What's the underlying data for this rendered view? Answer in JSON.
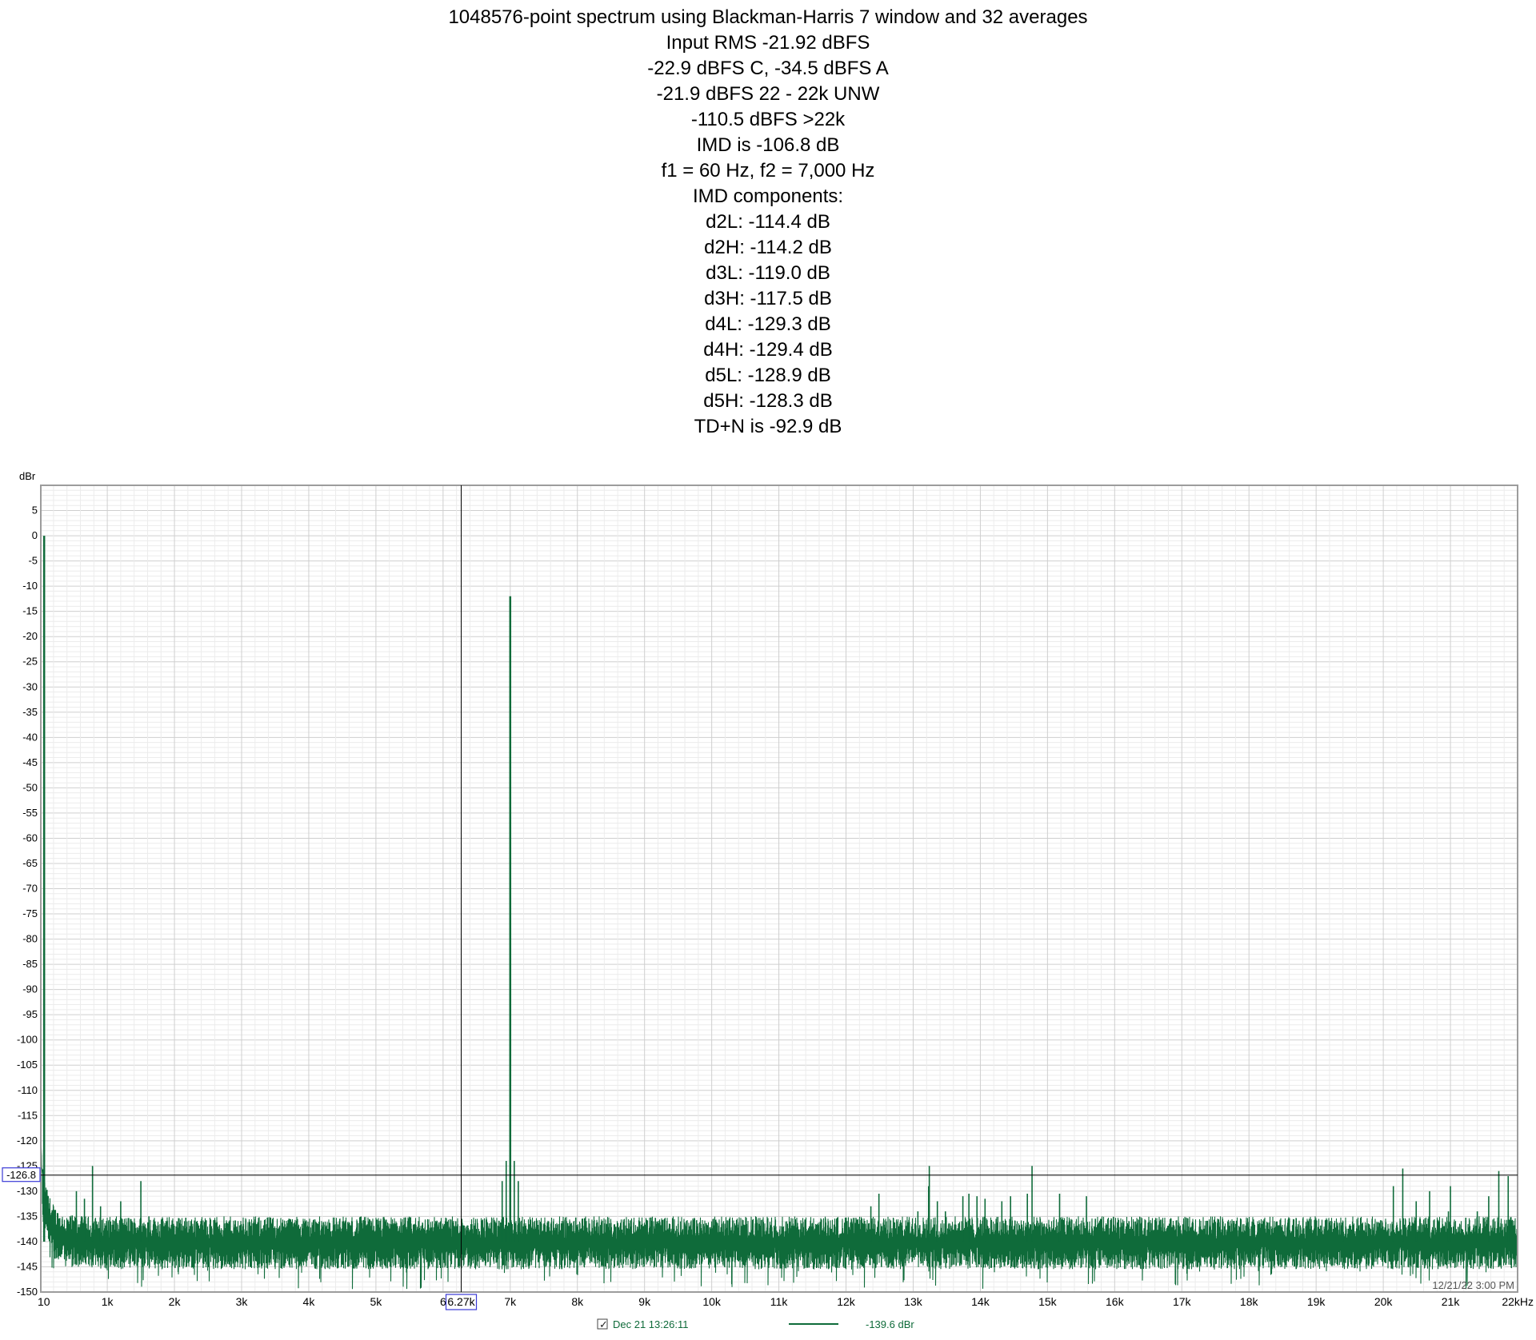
{
  "header": {
    "lines": [
      "1048576-point spectrum using Blackman-Harris 7 window and 32 averages",
      "Input RMS -21.92 dBFS",
      "-22.9 dBFS C, -34.5 dBFS A",
      "-21.9 dBFS 22 - 22k UNW",
      "-110.5 dBFS >22k",
      "IMD is -106.8 dB",
      "f1 = 60 Hz, f2 = 7,000 Hz",
      "IMD components:",
      "d2L: -114.4 dB",
      "d2H: -114.2 dB",
      "d3L: -119.0 dB",
      "d3H: -117.5 dB",
      "d4L: -129.3 dB",
      "d4H: -129.4 dB",
      "d5L: -128.9 dB",
      "d5H: -128.3 dB",
      "TD+N is -92.9 dB"
    ]
  },
  "chart_data": {
    "type": "line",
    "ylabel": "dBr",
    "ylim": [
      -150,
      10
    ],
    "xlim": [
      10,
      22000
    ],
    "x_scale": "linear",
    "grid": true,
    "y_ticks": [
      5,
      0,
      -5,
      -10,
      -15,
      -20,
      -25,
      -30,
      -35,
      -40,
      -45,
      -50,
      -55,
      -60,
      -65,
      -70,
      -75,
      -80,
      -85,
      -90,
      -95,
      -100,
      -105,
      -110,
      -115,
      -120,
      -125,
      -130,
      -135,
      -140,
      -145,
      -150
    ],
    "y_tick_labels": [
      "5",
      "0",
      "-5",
      "-10",
      "-15",
      "-20",
      "-25",
      "-30",
      "-35",
      "-40",
      "-45",
      "-50",
      "-55",
      "-60",
      "-65",
      "-70",
      "-75",
      "-80",
      "-85",
      "-90",
      "-95",
      "-100",
      "-105",
      "-110",
      "-115",
      "-120",
      "-125",
      "-130",
      "-135",
      "-140",
      "-145",
      "-150"
    ],
    "x_ticks": [
      10,
      1000,
      2000,
      3000,
      4000,
      5000,
      6000,
      7000,
      8000,
      9000,
      10000,
      11000,
      12000,
      13000,
      14000,
      15000,
      16000,
      17000,
      18000,
      19000,
      20000,
      21000,
      22000
    ],
    "x_tick_labels": [
      "10",
      "1k",
      "2k",
      "3k",
      "4k",
      "5k",
      "6",
      "7k",
      "8k",
      "9k",
      "10k",
      "11k",
      "12k",
      "13k",
      "14k",
      "15k",
      "16k",
      "17k",
      "18k",
      "19k",
      "20k",
      "21k",
      "22kHz"
    ],
    "noise_floor": -140,
    "series": [
      {
        "color": "#0f6b3a",
        "peaks": [
          {
            "x": 60,
            "y": 0
          },
          {
            "x": 780,
            "y": -125
          },
          {
            "x": 540,
            "y": -130
          },
          {
            "x": 660,
            "y": -131.5
          },
          {
            "x": 900,
            "y": -133
          },
          {
            "x": 1200,
            "y": -132
          },
          {
            "x": 1500,
            "y": -128
          },
          {
            "x": 1620,
            "y": -135
          },
          {
            "x": 2340,
            "y": -137
          },
          {
            "x": 6880,
            "y": -128
          },
          {
            "x": 6940,
            "y": -124
          },
          {
            "x": 7000,
            "y": -12
          },
          {
            "x": 7060,
            "y": -124
          },
          {
            "x": 7120,
            "y": -128
          },
          {
            "x": 12370,
            "y": -133
          },
          {
            "x": 12490,
            "y": -130.5
          },
          {
            "x": 13070,
            "y": -134
          },
          {
            "x": 13230,
            "y": -129
          },
          {
            "x": 13240,
            "y": -125
          },
          {
            "x": 13360,
            "y": -132
          },
          {
            "x": 13480,
            "y": -134
          },
          {
            "x": 13740,
            "y": -131
          },
          {
            "x": 13830,
            "y": -130.5
          },
          {
            "x": 13950,
            "y": -131
          },
          {
            "x": 14070,
            "y": -131.5
          },
          {
            "x": 14320,
            "y": -132
          },
          {
            "x": 14450,
            "y": -131
          },
          {
            "x": 14700,
            "y": -130.5
          },
          {
            "x": 14770,
            "y": -125
          },
          {
            "x": 15180,
            "y": -130.5
          },
          {
            "x": 15580,
            "y": -131
          },
          {
            "x": 19400,
            "y": -136
          },
          {
            "x": 20150,
            "y": -129
          },
          {
            "x": 20290,
            "y": -125.5
          },
          {
            "x": 20490,
            "y": -132
          },
          {
            "x": 20690,
            "y": -130
          },
          {
            "x": 20970,
            "y": -134
          },
          {
            "x": 21000,
            "y": -129
          },
          {
            "x": 21400,
            "y": -134
          },
          {
            "x": 21570,
            "y": -131
          },
          {
            "x": 21720,
            "y": -126
          },
          {
            "x": 21860,
            "y": -127
          }
        ]
      }
    ],
    "cursor": {
      "x": 6270,
      "y": -126.8,
      "x_label": "6.27k",
      "y_label": "-126.8"
    },
    "footer": {
      "timestamp": "12/21/22 3:00 PM",
      "legend_label": "Dec 21 13:26:11",
      "legend_value": "-139.6 dBr",
      "legend_checked": true
    }
  }
}
